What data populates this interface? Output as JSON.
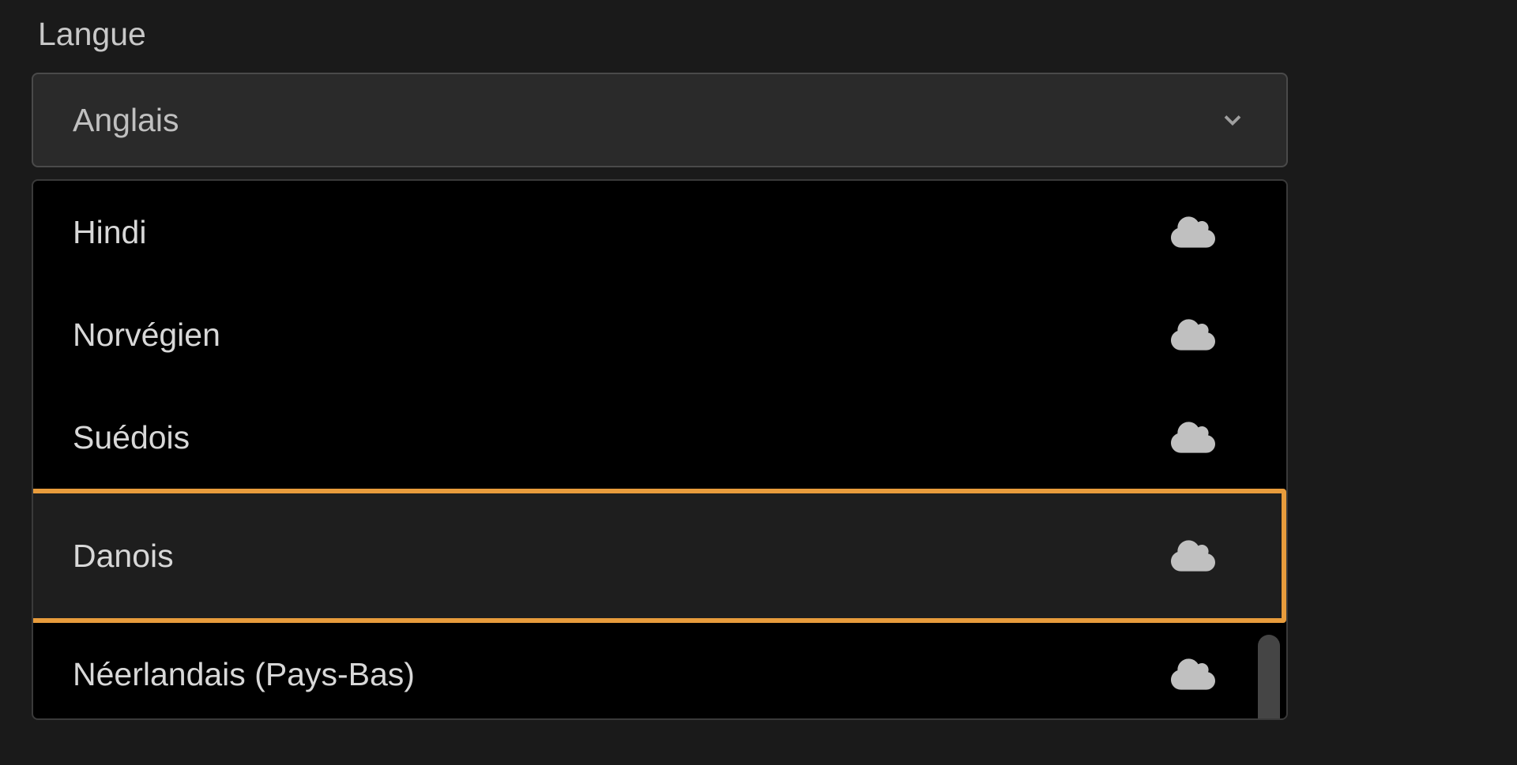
{
  "section": {
    "label": "Langue"
  },
  "select": {
    "value": "Anglais"
  },
  "options": [
    {
      "label": "Hindi",
      "highlighted": false
    },
    {
      "label": "Norvégien",
      "highlighted": false
    },
    {
      "label": "Suédois",
      "highlighted": false
    },
    {
      "label": "Danois",
      "highlighted": true
    },
    {
      "label": "Néerlandais (Pays-Bas)",
      "highlighted": false
    }
  ],
  "colors": {
    "background": "#1a1a1a",
    "selectBg": "#2a2a2a",
    "dropdownBg": "#000000",
    "highlight": "#e89c3c",
    "text": "#d0d0d0",
    "iconFill": "#c0c0c0"
  }
}
